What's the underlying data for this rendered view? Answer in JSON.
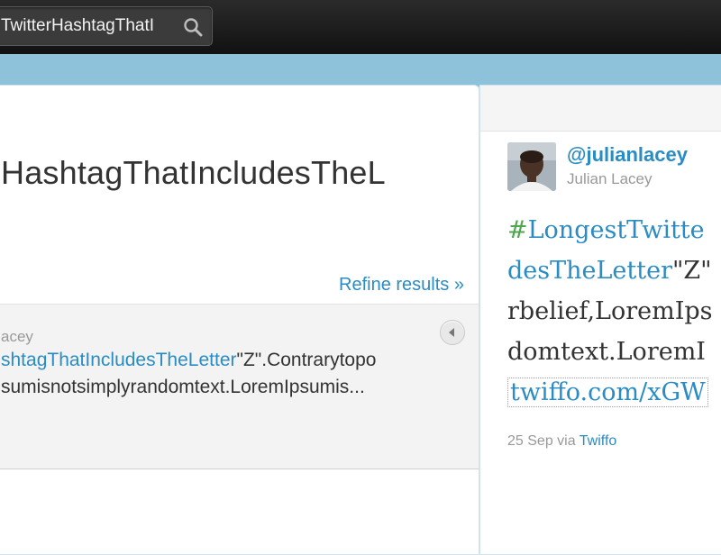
{
  "search": {
    "value": "TwitterHashtagThatI"
  },
  "results": {
    "title": "HashtagThatIncludesTheL",
    "refine_label": "Refine results »",
    "tweet": {
      "author": "acey",
      "hashtag": "shtagThatIncludesTheLetter",
      "line1_rest": "\"Z\".Contrarytopo",
      "line2": "sumisnotsimplyrandomtext.LoremIpsumis..."
    }
  },
  "detail": {
    "handle": "@julianlacey",
    "name": "Julian Lacey",
    "hash_symbol": "#",
    "line1_hashtag": "LongestTwitte",
    "line2_hashtag": "desTheLetter",
    "line2_rest": "\"Z\"",
    "line3": "rbelief,LoremIps",
    "line4": "domtext.LoremI",
    "url": "twiffo.com/xGW",
    "date": "25 Sep",
    "via": "via",
    "source": "Twiffo"
  },
  "colors": {
    "link": "#2a8cc4",
    "topbar": "#1a1a1a",
    "band": "#8ec1da"
  },
  "icons": {
    "search": "magnifier",
    "chevron": "chevron-left",
    "avatar": "profile-photo"
  }
}
